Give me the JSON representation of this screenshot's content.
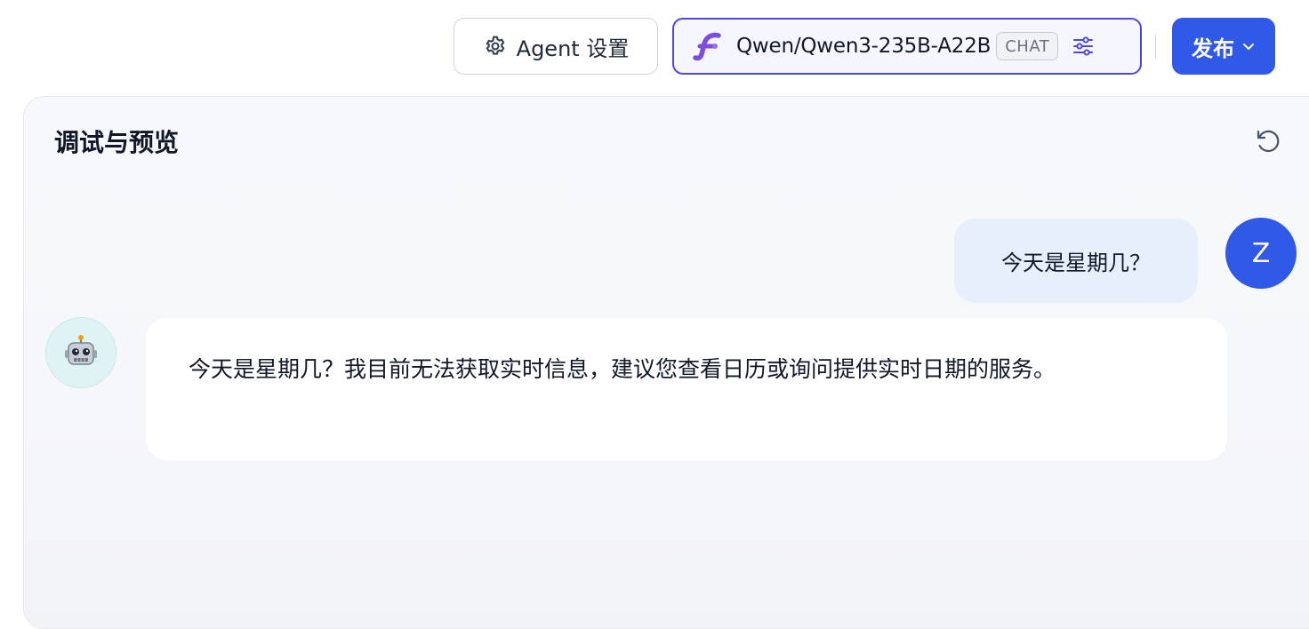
{
  "toolbar": {
    "agent_settings_label": "Agent 设置",
    "agent_settings_icon": "gear-icon",
    "model": {
      "name": "Qwen/Qwen3-235B-A22B",
      "badge": "CHAT",
      "logo_icon": "model-provider-logo-icon",
      "settings_icon": "sliders-icon",
      "accent_color": "#4f46e5"
    },
    "publish_label": "发布",
    "publish_icon": "chevron-down-icon",
    "publish_color": "#2f59e6"
  },
  "panel": {
    "title": "调试与预览",
    "refresh_icon": "refresh-icon"
  },
  "messages": [
    {
      "role": "user",
      "avatar_letter": "Z",
      "text": "今天是星期几？"
    },
    {
      "role": "assistant",
      "avatar_icon": "robot-icon",
      "text": "今天是星期几？我目前无法获取实时信息，建议您查看日历或询问提供实时日期的服务。"
    }
  ]
}
